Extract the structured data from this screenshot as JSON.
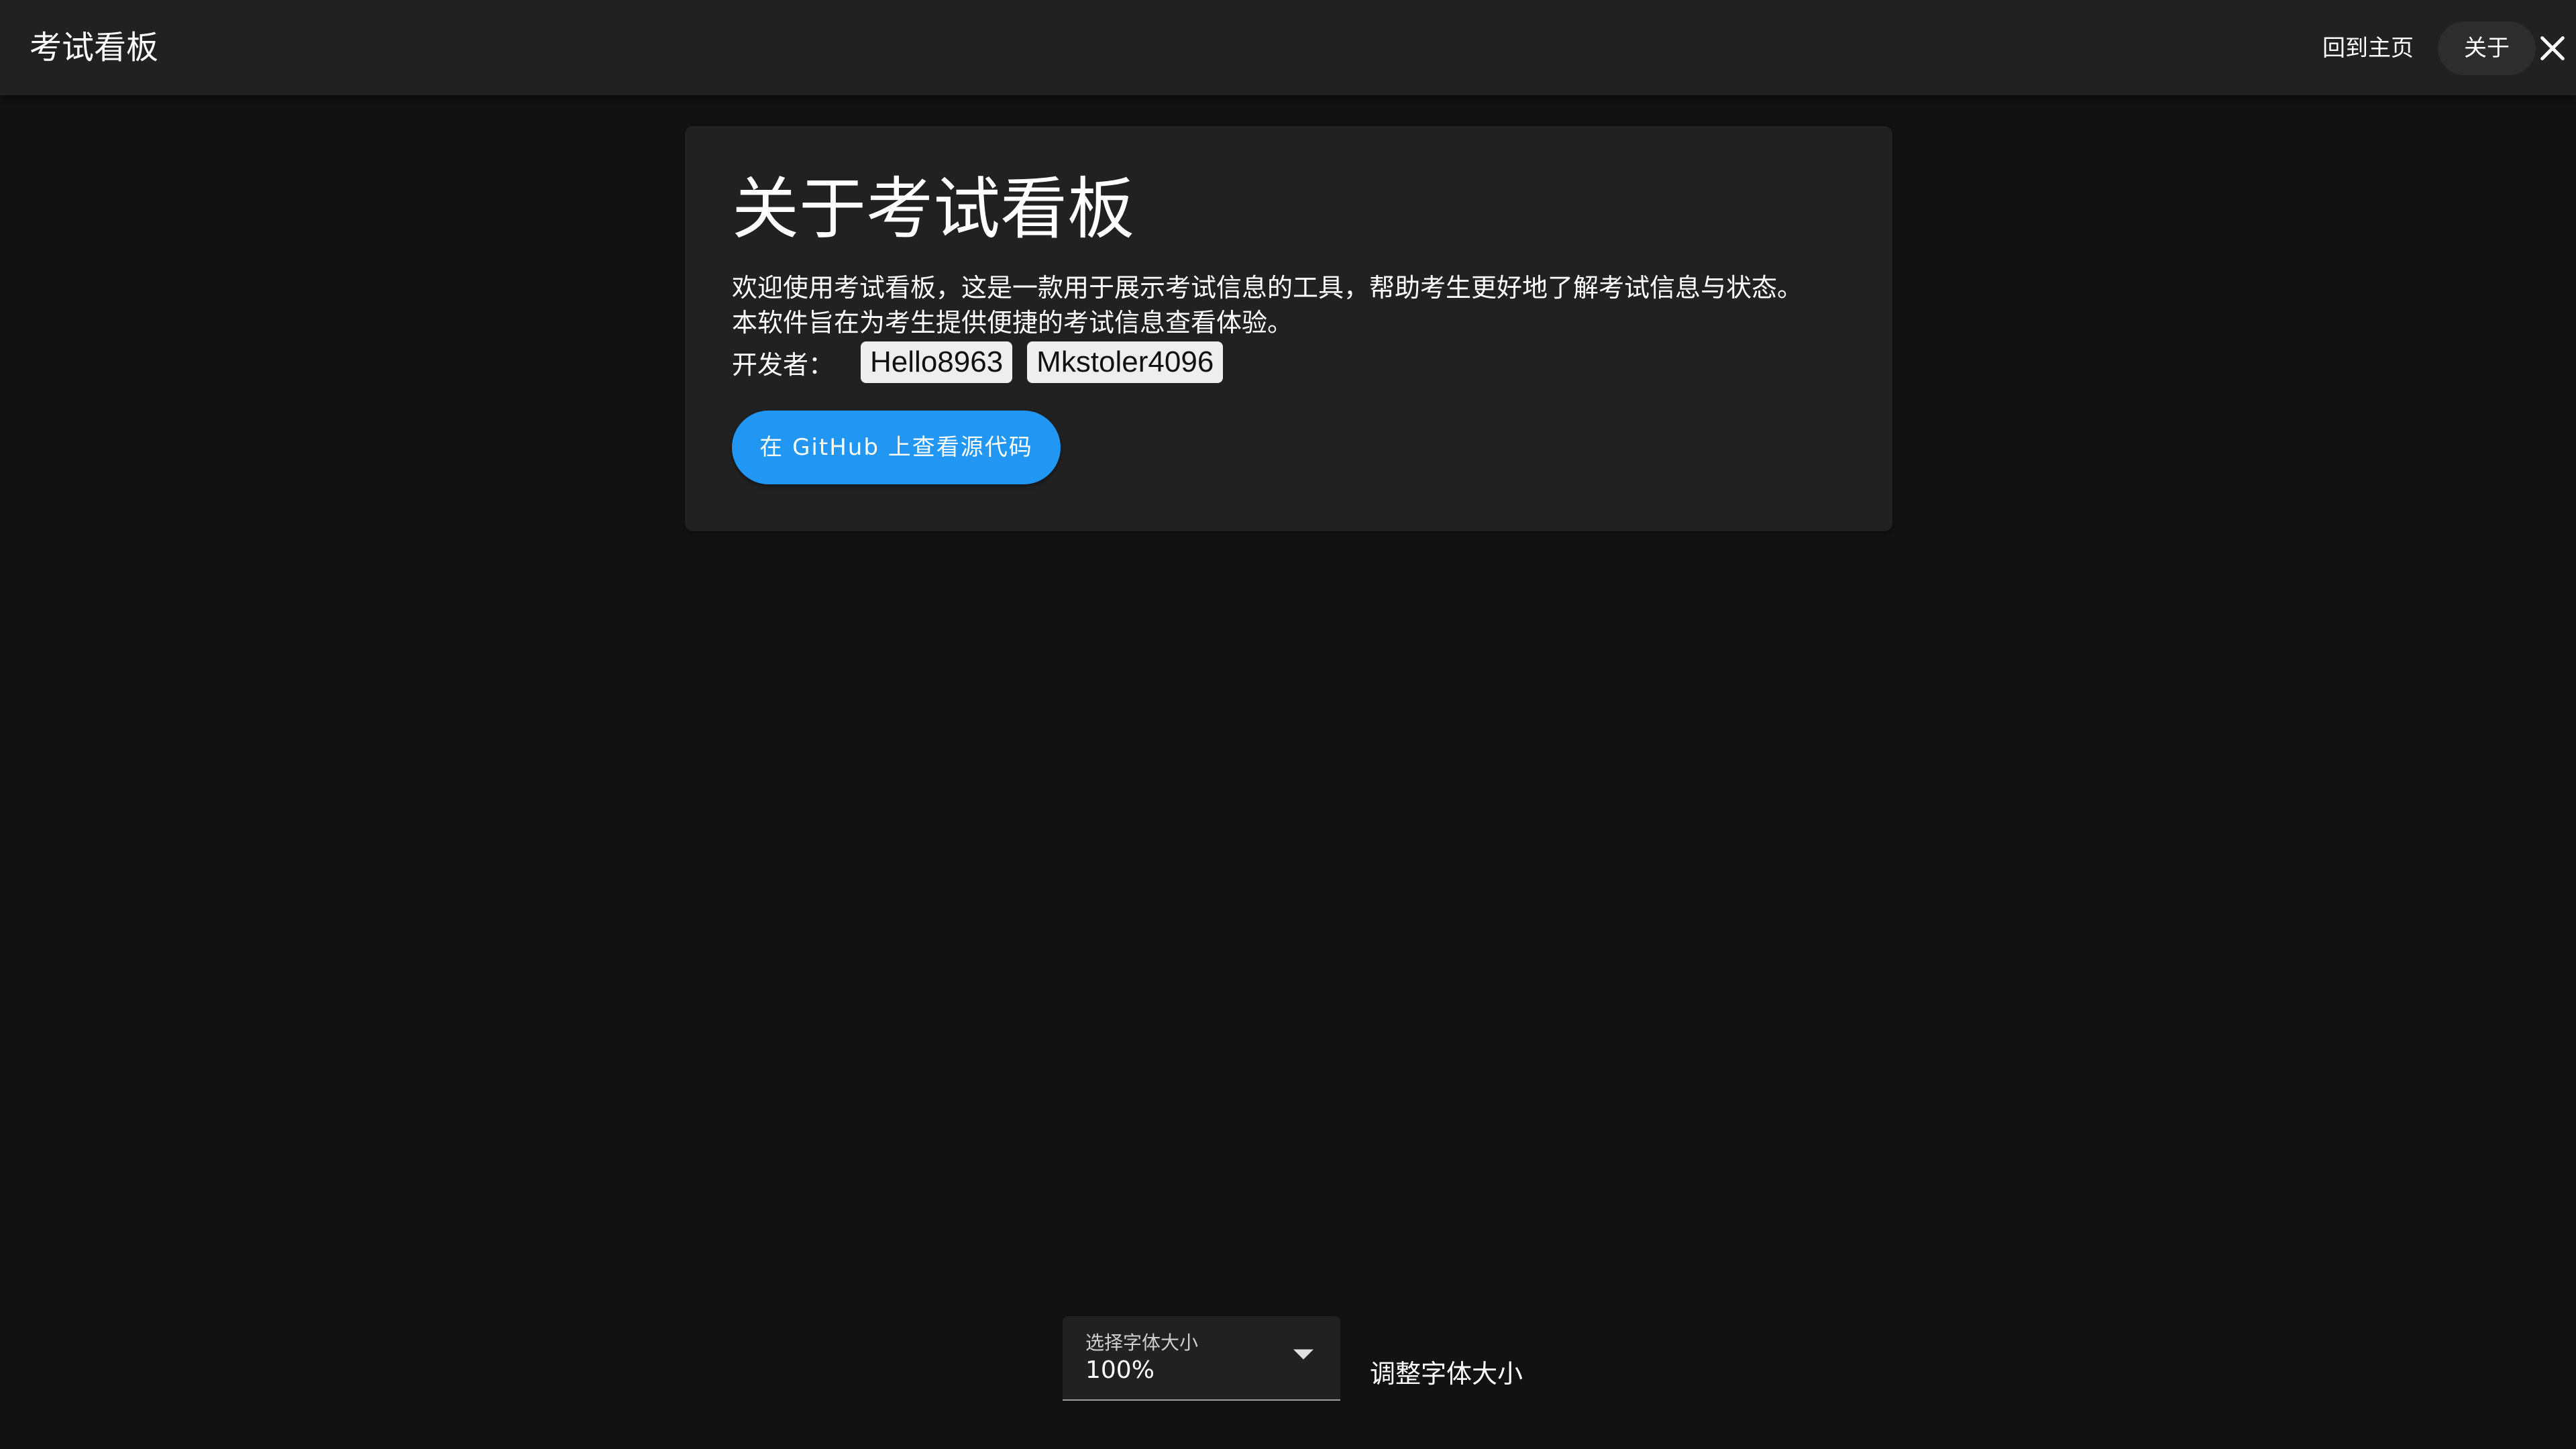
{
  "appbar": {
    "title": "考试看板",
    "nav_home": "回到主页",
    "nav_about": "关于"
  },
  "about": {
    "title": "关于考试看板",
    "line1": "欢迎使用考试看板，这是一款用于展示考试信息的工具，帮助考生更好地了解考试信息与状态。",
    "line2": "本软件旨在为考生提供便捷的考试信息查看体验。",
    "developers_label": "开发者：",
    "developers": [
      "Hello8963",
      "Mkstoler4096"
    ],
    "github_button": "在 GitHub 上查看源代码"
  },
  "font_size": {
    "label": "选择字体大小",
    "value": "100%",
    "hint": "调整字体大小"
  },
  "icons": {
    "close": "close-icon",
    "dropdown": "arrow-drop-down-icon"
  },
  "colors": {
    "background": "#121212",
    "surface": "#212121",
    "accent": "#2196f3"
  }
}
